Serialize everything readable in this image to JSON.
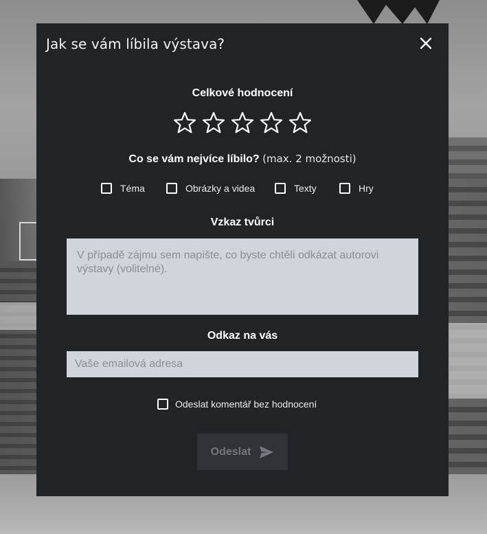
{
  "modal": {
    "title": "Jak se vám líbila výstava?",
    "close_icon": "close-icon"
  },
  "rating": {
    "title": "Celkové hodnocení",
    "max": 5,
    "value": 0,
    "star_icon": "star-outline-icon"
  },
  "likes": {
    "title": "Co se vám nejvíce líbilo?",
    "note": "(max. 2 možnosti)",
    "options": [
      {
        "label": "Téma",
        "checked": false
      },
      {
        "label": "Obrázky a videa",
        "checked": false
      },
      {
        "label": "Texty",
        "checked": false
      },
      {
        "label": "Hry",
        "checked": false
      }
    ]
  },
  "message": {
    "title": "Vzkaz tvůrci",
    "placeholder": "V případě zájmu sem napište, co byste chtěli odkázat autorovi výstavy (volitelné).",
    "value": ""
  },
  "contact": {
    "title": "Odkaz na vás",
    "placeholder": "Vaše emailová adresa",
    "value": ""
  },
  "no_rating": {
    "label": "Odeslat komentář bez hodnocení",
    "checked": false
  },
  "submit": {
    "label": "Odeslat",
    "icon": "send-icon",
    "enabled": false
  },
  "colors": {
    "modal_bg": "#212427",
    "input_bg": "#d0d4db",
    "button_bg": "#2f3237",
    "button_text": "#74777d"
  }
}
